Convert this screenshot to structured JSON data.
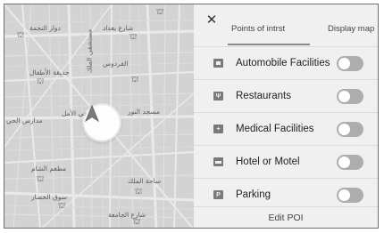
{
  "map": {
    "labels": [
      "دوار النجمة",
      "شارع بغداد",
      "مستشفى الملك",
      "مدارس الحي",
      "الفردوس",
      "حديقة الأطفال",
      "حي الأمل",
      "مسجد النور",
      "مطعم الشام",
      "سوق الخضار",
      "شارع الجامعة",
      "ساحة الملك"
    ],
    "vehicle_icon": "navigation-arrow-icon"
  },
  "panel": {
    "close_icon": "close-icon",
    "tabs": [
      {
        "label": "Points of intrst",
        "active": true
      },
      {
        "label": "Display map",
        "active": false
      }
    ],
    "categories": [
      {
        "label": "Automobile Facilities",
        "icon": "car-facility-icon",
        "on": false
      },
      {
        "label": "Restaurants",
        "icon": "restaurant-icon",
        "on": false
      },
      {
        "label": "Medical Facilities",
        "icon": "medical-icon",
        "on": false
      },
      {
        "label": "Hotel or Motel",
        "icon": "hotel-icon",
        "on": false
      },
      {
        "label": "Parking",
        "icon": "parking-icon",
        "on": false
      }
    ],
    "edit_label": "Edit POI"
  },
  "colors": {
    "map_bg": "#d3d3d3",
    "map_road": "#e9e9e9",
    "panel_bg": "#f0f0f0",
    "toggle_off": "#adadad"
  }
}
